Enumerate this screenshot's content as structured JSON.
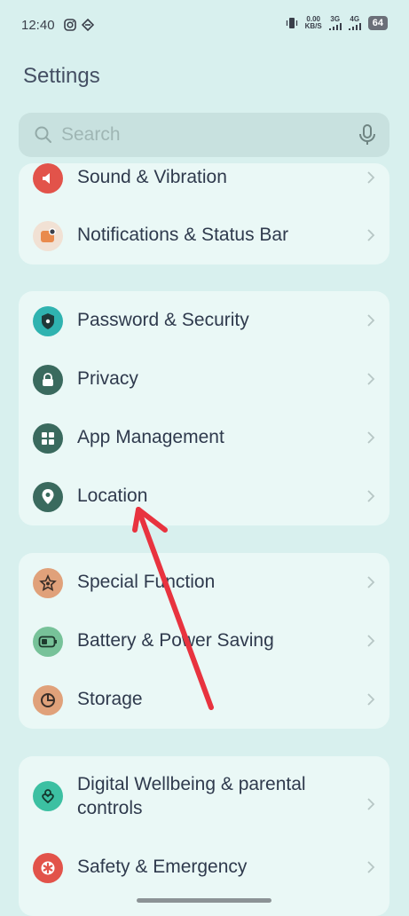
{
  "status_bar": {
    "time": "12:40",
    "net_speed_value": "0.00",
    "net_speed_unit": "KB/S",
    "signal1_label": "3G",
    "signal2_label": "4G",
    "battery": "64"
  },
  "header": {
    "title": "Settings"
  },
  "search": {
    "placeholder": "Search"
  },
  "cards": [
    {
      "items": [
        {
          "label": "Sound & Vibration",
          "icon": "speaker-icon",
          "color": "#e2534a"
        },
        {
          "label": "Notifications & Status Bar",
          "icon": "notification-icon",
          "color": "#e98a4d"
        }
      ]
    },
    {
      "items": [
        {
          "label": "Password & Security",
          "icon": "shield-icon",
          "color": "#2fb3b0"
        },
        {
          "label": "Privacy",
          "icon": "lock-icon",
          "color": "#3a6a5e"
        },
        {
          "label": "App Management",
          "icon": "apps-grid-icon",
          "color": "#3a6a5e"
        },
        {
          "label": "Location",
          "icon": "location-pin-icon",
          "color": "#3a6a5e"
        }
      ]
    },
    {
      "items": [
        {
          "label": "Special Function",
          "icon": "star-icon",
          "color": "#e0a17a"
        },
        {
          "label": "Battery & Power Saving",
          "icon": "battery-icon",
          "color": "#77c299"
        },
        {
          "label": "Storage",
          "icon": "pie-chart-icon",
          "color": "#e0a17a"
        }
      ]
    },
    {
      "items": [
        {
          "label": "Digital Wellbeing & parental controls",
          "icon": "wellbeing-heart-icon",
          "color": "#3cc0a2"
        },
        {
          "label": "Safety & Emergency",
          "icon": "emergency-icon",
          "color": "#e2534a"
        }
      ]
    }
  ],
  "annotation": {
    "arrow_color": "#e8333f"
  }
}
